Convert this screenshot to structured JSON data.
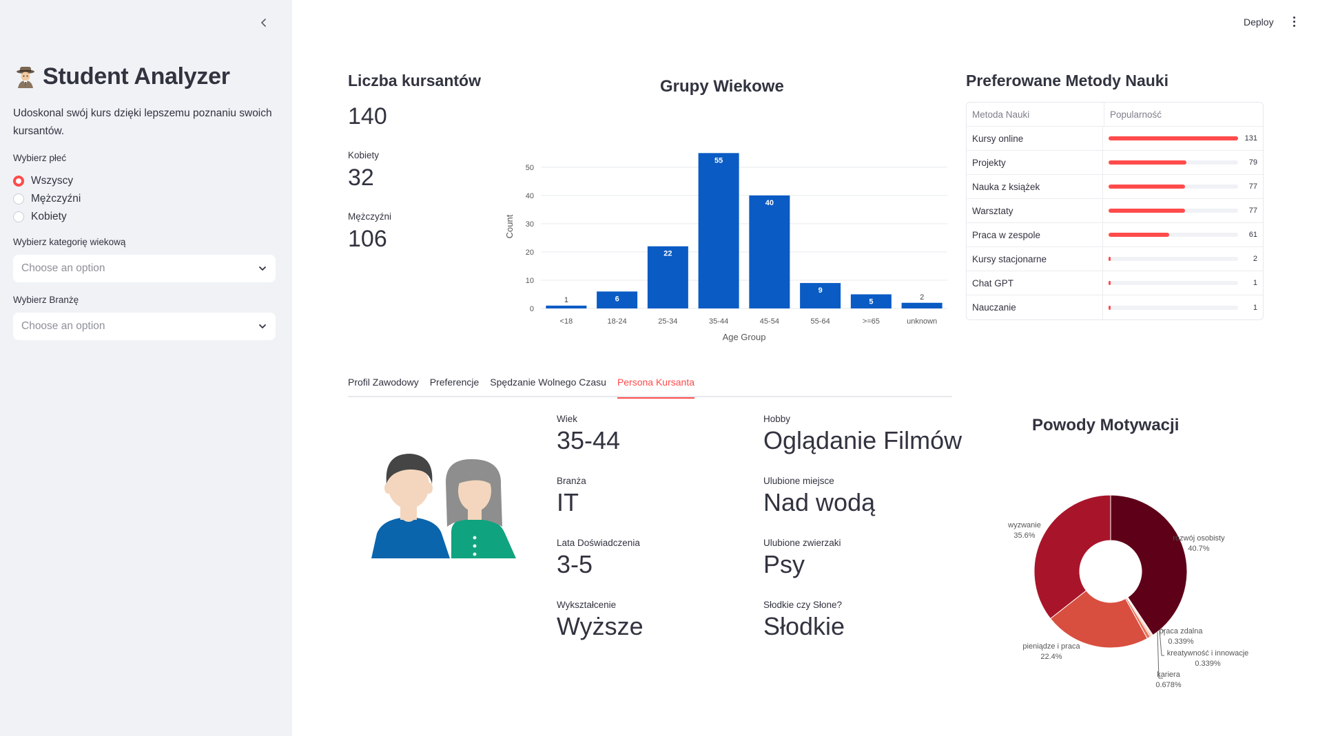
{
  "sidebar": {
    "collapse_label": "‹",
    "title": "Student Analyzer",
    "title_icon": "detective-emoji",
    "description": "Udoskonal swój kurs dzięki lepszemu poznaniu swoich kursantów.",
    "gender_label": "Wybierz płeć",
    "gender_options": [
      "Wszyscy",
      "Mężczyźni",
      "Kobiety"
    ],
    "gender_selected": "Wszyscy",
    "age_label": "Wybierz kategorię wiekową",
    "age_placeholder": "Choose an option",
    "industry_label": "Wybierz Branżę",
    "industry_placeholder": "Choose an option"
  },
  "topbar": {
    "deploy_label": "Deploy"
  },
  "metrics": {
    "heading": "Liczba kursantów",
    "total": "140",
    "women_label": "Kobiety",
    "women": "32",
    "men_label": "Mężczyźni",
    "men": "106"
  },
  "chart_data": {
    "type": "bar",
    "title": "Grupy Wiekowe",
    "xlabel": "Age Group",
    "ylabel": "Count",
    "categories": [
      "<18",
      "18-24",
      "25-34",
      "35-44",
      "45-54",
      "55-64",
      ">=65",
      "unknown"
    ],
    "values": [
      1,
      6,
      22,
      55,
      40,
      9,
      5,
      2
    ],
    "yticks": [
      0,
      10,
      20,
      30,
      40,
      50
    ],
    "ylim": [
      0,
      58
    ],
    "color": "#0a5bc4",
    "grid": true
  },
  "methods": {
    "heading": "Preferowane Metody Nauki",
    "col1": "Metoda Nauki",
    "col2": "Popularność",
    "max": 131,
    "rows": [
      {
        "name": "Kursy online",
        "value": 131
      },
      {
        "name": "Projekty",
        "value": 79
      },
      {
        "name": "Nauka z książek",
        "value": 77
      },
      {
        "name": "Warsztaty",
        "value": 77
      },
      {
        "name": "Praca w zespole",
        "value": 61
      },
      {
        "name": "Kursy stacjonarne",
        "value": 2
      },
      {
        "name": "Chat GPT",
        "value": 1
      },
      {
        "name": "Nauczanie",
        "value": 1
      }
    ]
  },
  "tabs": [
    "Profil Zawodowy",
    "Preferencje",
    "Spędzanie Wolnego Czasu",
    "Persona Kursanta"
  ],
  "active_tab": "Persona Kursanta",
  "persona": {
    "age_label": "Wiek",
    "age": "35-44",
    "industry_label": "Branża",
    "industry": "IT",
    "experience_label": "Lata Doświadczenia",
    "experience": "3-5",
    "education_label": "Wykształcenie",
    "education": "Wyższe",
    "hobby_label": "Hobby",
    "hobby": "Oglądanie Filmów",
    "place_label": "Ulubione miejsce",
    "place": "Nad wodą",
    "animals_label": "Ulubione zwierzaki",
    "animals": "Psy",
    "taste_label": "Słodkie czy Słone?",
    "taste": "Słodkie"
  },
  "motivation": {
    "title": "Powody Motywacji",
    "slices": [
      {
        "label": "rozwój osobisty",
        "pct": "40.7%",
        "value": 40.7,
        "color": "#5e0018"
      },
      {
        "label": "praca zdalna",
        "pct": "0.339%",
        "value": 0.339,
        "color": "#f8d5c8"
      },
      {
        "label": "kreatywność i innowacje",
        "pct": "0.339%",
        "value": 0.339,
        "color": "#f3a48d"
      },
      {
        "label": "kariera",
        "pct": "0.678%",
        "value": 0.678,
        "color": "#e77257"
      },
      {
        "label": "pieniądze i praca",
        "pct": "22.4%",
        "value": 22.4,
        "color": "#d84f3f"
      },
      {
        "label": "wyzwanie",
        "pct": "35.6%",
        "value": 35.6,
        "color": "#a8152a"
      }
    ]
  }
}
